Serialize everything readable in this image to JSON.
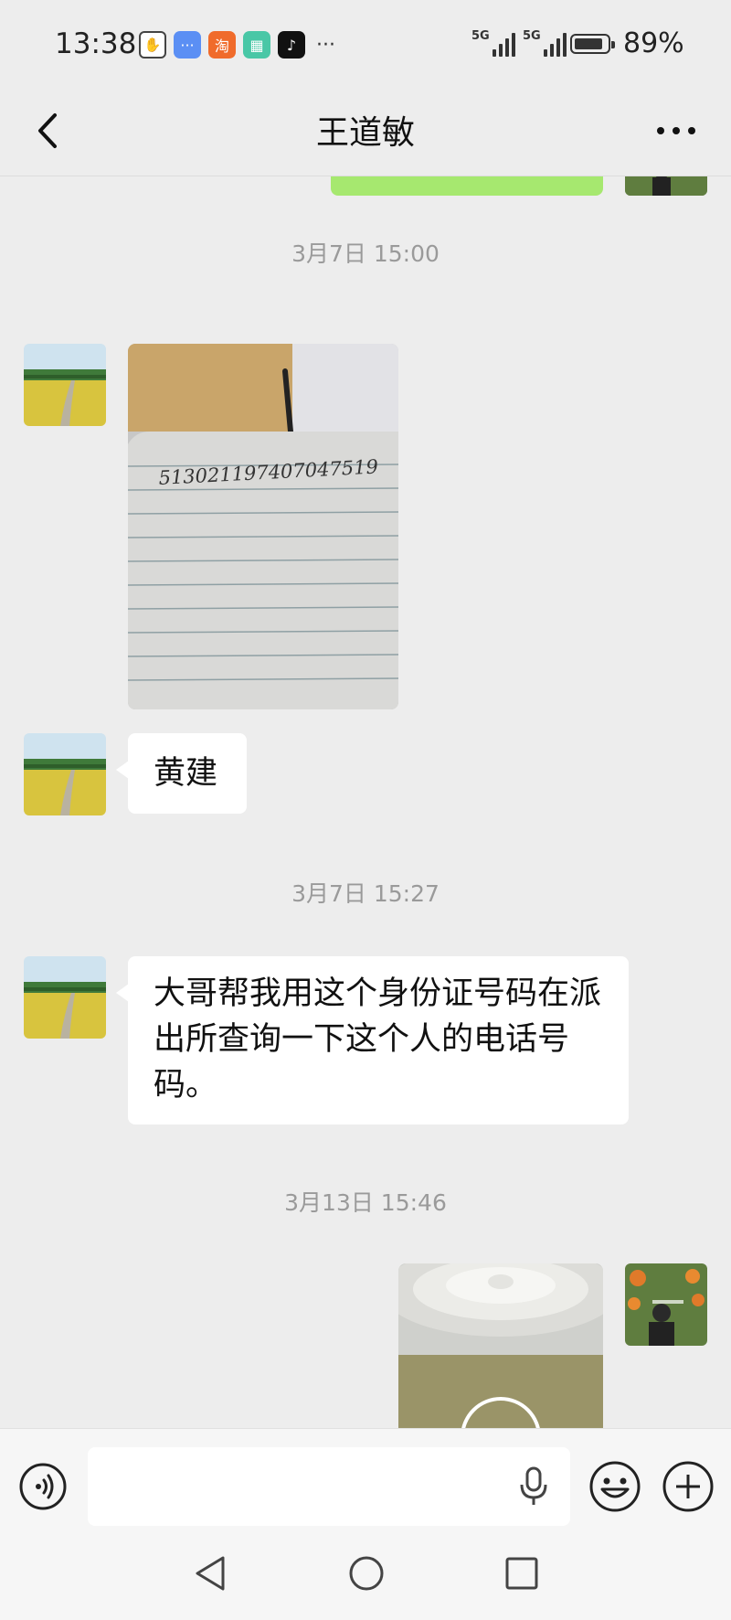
{
  "status_bar": {
    "time": "13:38",
    "notification_icons": [
      "blocked-hand-icon",
      "message-app-icon",
      "taobao-icon",
      "calendar-app-icon",
      "tiktok-icon"
    ],
    "notification_taobao_glyph": "淘",
    "more_notifications": "···",
    "signal_labels": [
      "5G",
      "5G"
    ],
    "battery_percent_text": "89%",
    "battery_level": 0.89
  },
  "header": {
    "back_icon": "chevron-left-icon",
    "title": "王道敏",
    "more_icon": "more-dots-icon"
  },
  "messages": [
    {
      "type": "image",
      "side": "right",
      "sender": "self",
      "note": "partially visible green bubble"
    },
    {
      "type": "timestamp",
      "text": "3月7日 15:00"
    },
    {
      "type": "image",
      "side": "left",
      "sender": "contact",
      "handwritten_text": "513021197407047519"
    },
    {
      "type": "text",
      "side": "left",
      "sender": "contact",
      "text": "黄建"
    },
    {
      "type": "timestamp",
      "text": "3月7日 15:27"
    },
    {
      "type": "text",
      "side": "left",
      "sender": "contact",
      "text": "大哥帮我用这个身份证号码在派出所查询一下这个人的电话号码。"
    },
    {
      "type": "timestamp",
      "text": "3月13日 15:46"
    },
    {
      "type": "video",
      "side": "right",
      "sender": "self"
    }
  ],
  "input_bar": {
    "voice_icon": "voice-mode-icon",
    "input_value": "",
    "mic_icon": "microphone-icon",
    "emoji_icon": "emoji-icon",
    "plus_icon": "plus-icon"
  },
  "nav_bar": {
    "back_icon": "nav-back-icon",
    "home_icon": "nav-home-icon",
    "recent_icon": "nav-recent-icon"
  },
  "colors": {
    "background": "#ededed",
    "bubble_self": "#95ec69",
    "bubble_other": "#ffffff",
    "timestamp": "#9a9a9a"
  }
}
